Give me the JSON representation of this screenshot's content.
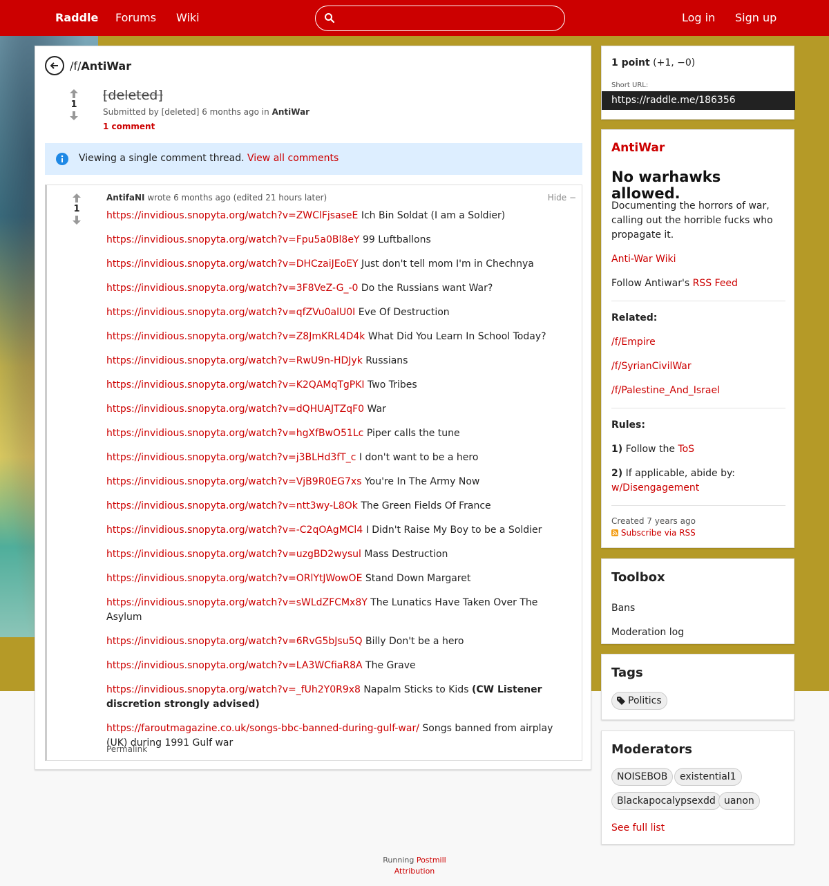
{
  "nav": {
    "brand": "Raddle",
    "forums": "Forums",
    "wiki": "Wiki",
    "login": "Log in",
    "signup": "Sign up",
    "search_placeholder": ""
  },
  "breadcrumb": {
    "prefix": "/f/",
    "forum": "AntiWar"
  },
  "post": {
    "score": "1",
    "title": "[deleted]",
    "submitted_by": "Submitted by [deleted] 6 months ago in",
    "forum": "AntiWar",
    "comments": "1 comment"
  },
  "alert": {
    "text": "Viewing a single comment thread.",
    "link": "View all comments"
  },
  "comment": {
    "score": "1",
    "author": "AntifaNI",
    "meta": "wrote 6 months ago (edited 21 hours later)",
    "hide": "Hide −",
    "permalink": "Permalink",
    "links": [
      {
        "url": "https://invidious.snopyta.org/watch?v=ZWClFjsaseE",
        "text": "Ich Bin Soldat (I am a Soldier)"
      },
      {
        "url": "https://invidious.snopyta.org/watch?v=Fpu5a0Bl8eY",
        "text": "99 Luftballons"
      },
      {
        "url": "https://invidious.snopyta.org/watch?v=DHCzaiJEoEY",
        "text": "Just don't tell mom I'm in Chechnya"
      },
      {
        "url": "https://invidious.snopyta.org/watch?v=3F8VeZ-G_-0",
        "text": "Do the Russians want War?"
      },
      {
        "url": "https://invidious.snopyta.org/watch?v=qfZVu0alU0I",
        "text": "Eve Of Destruction"
      },
      {
        "url": "https://invidious.snopyta.org/watch?v=Z8JmKRL4D4k",
        "text": "What Did You Learn In School Today?"
      },
      {
        "url": "https://invidious.snopyta.org/watch?v=RwU9n-HDJyk",
        "text": "Russians"
      },
      {
        "url": "https://invidious.snopyta.org/watch?v=K2QAMqTgPKI",
        "text": "Two Tribes"
      },
      {
        "url": "https://invidious.snopyta.org/watch?v=dQHUAJTZqF0",
        "text": "War"
      },
      {
        "url": "https://invidious.snopyta.org/watch?v=hgXfBwO51Lc",
        "text": "Piper calls the tune"
      },
      {
        "url": "https://invidious.snopyta.org/watch?v=j3BLHd3fT_c",
        "text": "I don't want to be a hero"
      },
      {
        "url": "https://invidious.snopyta.org/watch?v=VjB9R0EG7xs",
        "text": "You're In The Army Now"
      },
      {
        "url": "https://invidious.snopyta.org/watch?v=ntt3wy-L8Ok",
        "text": "The Green Fields Of France"
      },
      {
        "url": "https://invidious.snopyta.org/watch?v=-C2qOAgMCl4",
        "text": "I Didn't Raise My Boy to be a Soldier"
      },
      {
        "url": "https://invidious.snopyta.org/watch?v=uzgBD2wysul",
        "text": "Mass Destruction"
      },
      {
        "url": "https://invidious.snopyta.org/watch?v=ORlYtJWowOE",
        "text": "Stand Down Margaret"
      },
      {
        "url": "https://invidious.snopyta.org/watch?v=sWLdZFCMx8Y",
        "text": "The Lunatics Have Taken Over The Asylum"
      },
      {
        "url": "https://invidious.snopyta.org/watch?v=6RvG5bJsu5Q",
        "text": "Billy Don't be a hero"
      },
      {
        "url": "https://invidious.snopyta.org/watch?v=LA3WCfiaR8A",
        "text": "The Grave"
      }
    ],
    "napalm_url": "https://invidious.snopyta.org/watch?v=_fUh2Y0R9x8",
    "napalm_text": "Napalm Sticks to Kids",
    "napalm_note": "(CW Listener discretion strongly advised)",
    "farout_url": "https://faroutmagazine.co.uk/songs-bbc-banned-during-gulf-war/",
    "farout_text": "Songs banned from airplay (UK) during 1991 Gulf war"
  },
  "sidebar": {
    "points": "1 point",
    "points_detail": "(+1, −0)",
    "short_url_label": "Short URL:",
    "short_url": "https://raddle.me/186356",
    "forum_name": "AntiWar",
    "tagline": "No warhawks allowed.",
    "description": "Documenting the horrors of war, calling out the horrible fucks who propagate it.",
    "wiki_link": "Anti-War Wiki",
    "follow_prefix": "Follow Antiwar's",
    "rss_feed": "RSS Feed",
    "related_label": "Related:",
    "related": [
      "/f/Empire",
      "/f/SyrianCivilWar",
      "/f/Palestine_And_Israel"
    ],
    "rules_label": "Rules:",
    "rule1_num": "1)",
    "rule1_text": "Follow the",
    "rule1_link": "ToS",
    "rule2_num": "2)",
    "rule2_text": "If applicable, abide by:",
    "rule2_link": "w/Disengagement",
    "created": "Created 7 years ago",
    "subscribe": "Subscribe via RSS",
    "toolbox_title": "Toolbox",
    "bans": "Bans",
    "modlog": "Moderation log",
    "tags_title": "Tags",
    "tag": "Politics",
    "mods_title": "Moderators",
    "mods": [
      "NOISEBOB",
      "existential1",
      "Blackapocalypsexdd",
      "uanon"
    ],
    "see_full": "See full list"
  },
  "footer": {
    "running": "Running",
    "postmill": "Postmill",
    "attribution": "Attribution"
  },
  "colors": {
    "brand_red": "#cc0000",
    "link_red": "#cc0000",
    "band": "#b59a27"
  }
}
